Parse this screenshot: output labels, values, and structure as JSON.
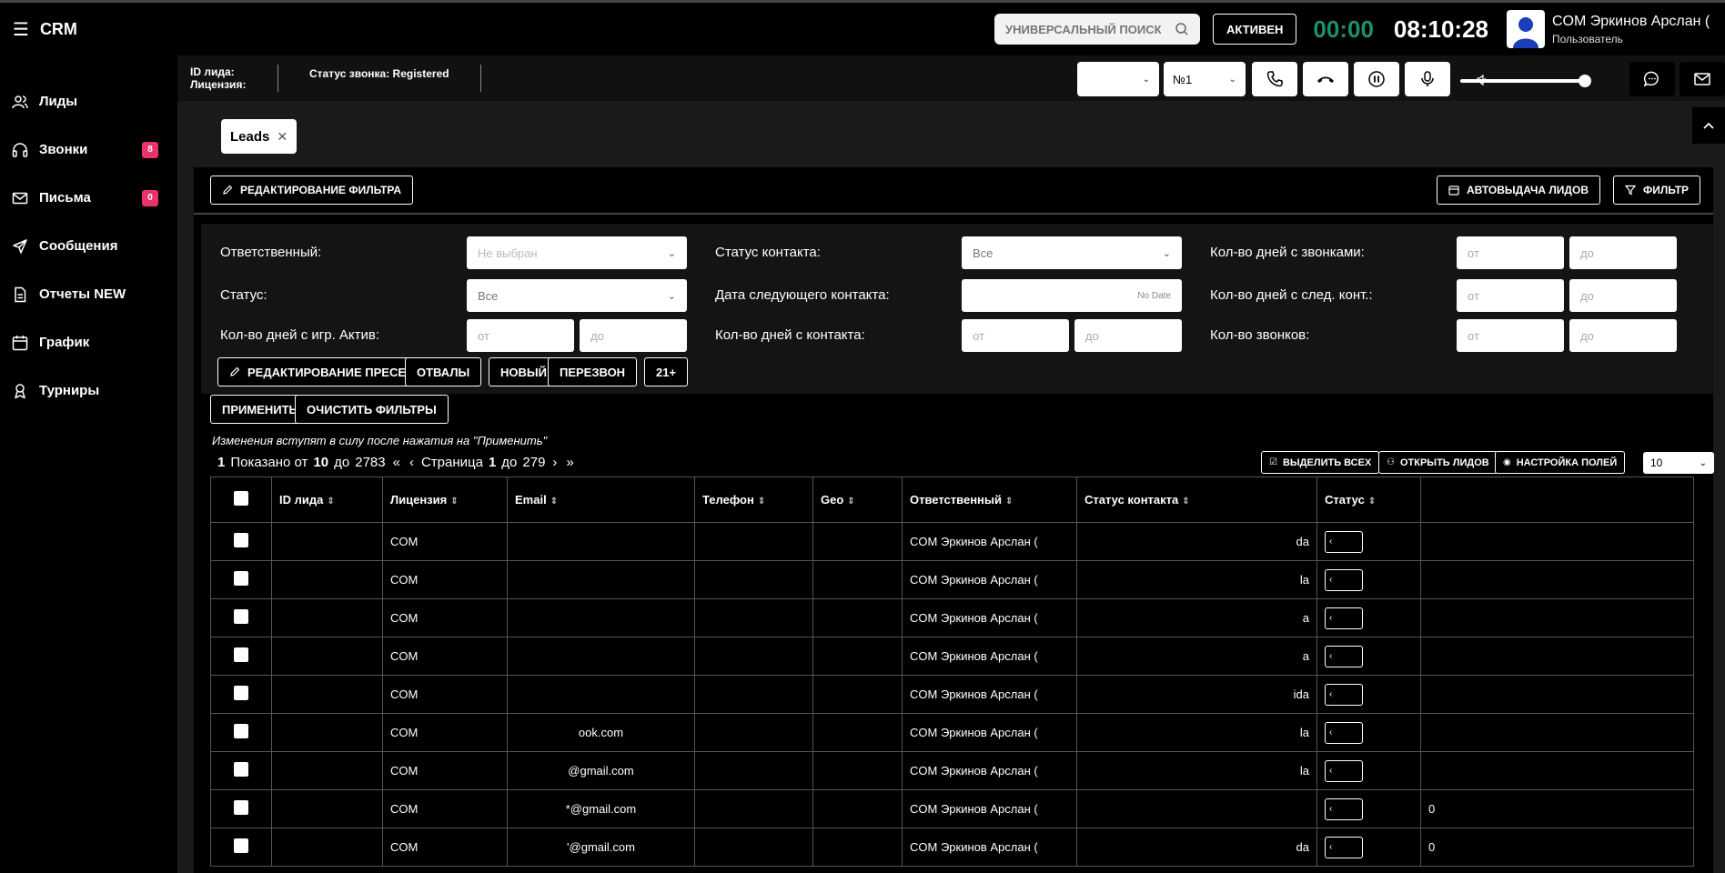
{
  "app": {
    "menu_icon": "hamburger-icon",
    "title": "CRM"
  },
  "header": {
    "search_label": "УНИВЕРСАЛЬНЫЙ ПОИСК",
    "active_label": "АКТИВЕН",
    "timer_call": "00:00",
    "timer_session": "08:10:28",
    "user_name": "COM Эркинов Арслан (",
    "user_role": "Пользователь"
  },
  "sidebar": {
    "items": [
      {
        "label": "Лиды",
        "icon": "users-icon"
      },
      {
        "label": "Звонки",
        "icon": "headset-icon",
        "badge": "8"
      },
      {
        "label": "Письма",
        "icon": "mail-icon",
        "badge": "0"
      },
      {
        "label": "Сообщения",
        "icon": "send-icon"
      },
      {
        "label": "Отчеты NEW",
        "icon": "report-icon"
      },
      {
        "label": "График",
        "icon": "calendar-icon"
      },
      {
        "label": "Турниры",
        "icon": "trophy-icon"
      }
    ]
  },
  "callbar": {
    "lead_id_label": "ID лида:",
    "license_label": "Лицензия:",
    "call_status": "Статус звонка: Registered",
    "line_select": "№1"
  },
  "tabs": {
    "leads": "Leads"
  },
  "toolbar": {
    "edit_filter": "РЕДАКТИРОВАНИЕ ФИЛЬТРА",
    "auto_leads": "АВТОВЫДАЧА ЛИДОВ",
    "filter": "ФИЛЬТР"
  },
  "filters": {
    "responsible_label": "Ответственный:",
    "responsible_value": "Не выбран",
    "status_label": "Статус:",
    "status_value": "Все",
    "game_active_days_label": "Кол-во дней с игр. Актив:",
    "contact_status_label": "Статус контакта:",
    "contact_status_value": "Все",
    "next_contact_date_label": "Дата следующего контакта:",
    "next_contact_date_value": "No Date",
    "days_since_contact_label": "Кол-во дней с контакта:",
    "days_with_calls_label": "Кол-во дней с звонками:",
    "days_next_contact_label": "Кол-во дней с след. конт.:",
    "calls_count_label": "Кол-во звонков:",
    "from_placeholder": "от",
    "to_placeholder": "до"
  },
  "presets": {
    "edit_presets": "РЕДАКТИРОВАНИЕ ПРЕСЕТОВ",
    "items": [
      "ОТВАЛЫ",
      "НОВЫЙ",
      "ПЕРЕЗВОН",
      "21+"
    ]
  },
  "actions": {
    "apply": "ПРИМЕНИТЬ",
    "clear": "ОЧИСТИТЬ ФИЛЬТРЫ"
  },
  "note": "Изменения вступят в силу после нажатия на \"Применить\"",
  "pagination": {
    "from": "1",
    "shown_label": "Показано от",
    "shown": "10",
    "to_label": "до",
    "total": "2783",
    "page_label": "Страница",
    "page": "1",
    "page_to_label": "до",
    "pages": "279"
  },
  "table_tools": {
    "select_all": "ВЫДЕЛИТЬ ВСЕХ",
    "open_leads": "ОТКРЫТЬ ЛИДОВ",
    "field_settings": "НАСТРОЙКА ПОЛЕЙ",
    "per_page": "10"
  },
  "table": {
    "columns": [
      "ID лида",
      "Лицензия",
      "Email",
      "Телефон",
      "Geo",
      "Ответственный",
      "Статус контакта",
      "Статус"
    ],
    "rows": [
      {
        "license": "COM",
        "email": "",
        "responsible": "COM Эркинов Арслан (",
        "contact_status": "da",
        "extra": ""
      },
      {
        "license": "COM",
        "email": "",
        "responsible": "COM Эркинов Арслан (",
        "contact_status": "la",
        "extra": ""
      },
      {
        "license": "COM",
        "email": "",
        "responsible": "COM Эркинов Арслан (",
        "contact_status": "a",
        "extra": ""
      },
      {
        "license": "COM",
        "email": "",
        "responsible": "COM Эркинов Арслан (",
        "contact_status": "a",
        "extra": ""
      },
      {
        "license": "COM",
        "email": "",
        "responsible": "COM Эркинов Арслан (",
        "contact_status": "ida",
        "extra": ""
      },
      {
        "license": "COM",
        "email": "ook.com",
        "responsible": "COM Эркинов Арслан (",
        "contact_status": "la",
        "extra": ""
      },
      {
        "license": "COM",
        "email": "@gmail.com",
        "responsible": "COM Эркинов Арслан (",
        "contact_status": "la",
        "extra": ""
      },
      {
        "license": "COM",
        "email": "*@gmail.com",
        "responsible": "COM Эркинов Арслан (",
        "contact_status": "",
        "extra": "0"
      },
      {
        "license": "COM",
        "email": "'@gmail.com",
        "responsible": "COM Эркинов Арслан (",
        "contact_status": "da",
        "extra": "0"
      }
    ]
  },
  "colors": {
    "accent_green": "#1e8e6e",
    "badge_pink": "#e8336b"
  }
}
